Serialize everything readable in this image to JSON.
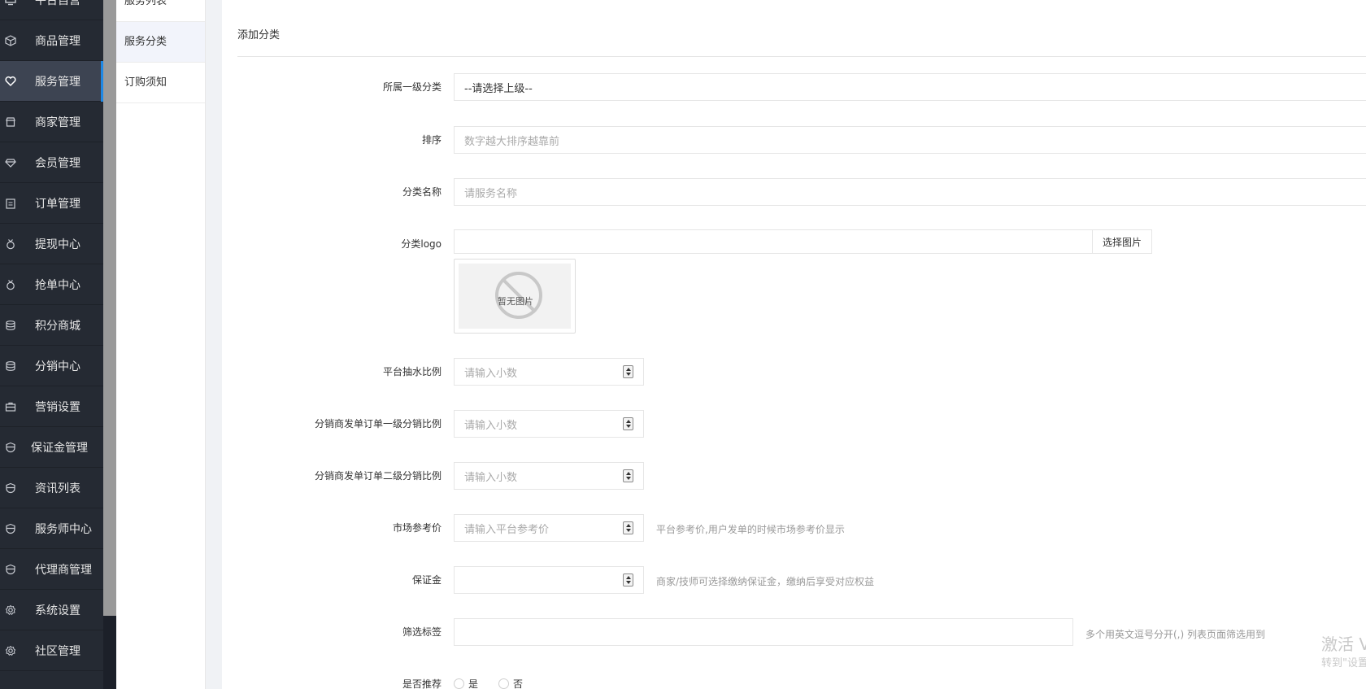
{
  "sidebar": {
    "items": [
      {
        "label": "平台自营",
        "icon": "monitor-icon"
      },
      {
        "label": "商品管理",
        "icon": "cube-icon"
      },
      {
        "label": "服务管理",
        "icon": "heart-icon",
        "active": true
      },
      {
        "label": "商家管理",
        "icon": "store-icon"
      },
      {
        "label": "会员管理",
        "icon": "diamond-icon"
      },
      {
        "label": "订单管理",
        "icon": "clipboard-icon"
      },
      {
        "label": "提现中心",
        "icon": "medal-icon"
      },
      {
        "label": "抢单中心",
        "icon": "medal-icon"
      },
      {
        "label": "积分商城",
        "icon": "database-icon"
      },
      {
        "label": "分销中心",
        "icon": "database-icon"
      },
      {
        "label": "营销设置",
        "icon": "briefcase-icon"
      },
      {
        "label": "保证金管理",
        "icon": "shield-icon"
      },
      {
        "label": "资讯列表",
        "icon": "shield-icon"
      },
      {
        "label": "服务师中心",
        "icon": "shield-icon"
      },
      {
        "label": "代理商管理",
        "icon": "shield-icon"
      },
      {
        "label": "系统设置",
        "icon": "gear-icon"
      },
      {
        "label": "社区管理",
        "icon": "gear-icon"
      },
      {
        "label": "",
        "icon": "gear-icon"
      }
    ]
  },
  "subnav": {
    "items": [
      {
        "label": "服务列表"
      },
      {
        "label": "服务分类",
        "active": true
      },
      {
        "label": "订购须知"
      }
    ]
  },
  "form": {
    "title": "添加分类",
    "parent_label": "所属一级分类",
    "parent_value": "--请选择上级--",
    "sort_label": "排序",
    "sort_placeholder": "数字越大排序越靠前",
    "name_label": "分类名称",
    "name_placeholder": "请服务名称",
    "logo_label": "分类logo",
    "logo_button": "选择图片",
    "no_image_text": "暂无图片",
    "commission_label": "平台抽水比例",
    "commission_placeholder": "请输入小数",
    "level1_label": "分销商发单订单一级分销比例",
    "level1_placeholder": "请输入小数",
    "level2_label": "分销商发单订单二级分销比例",
    "level2_placeholder": "请输入小数",
    "market_label": "市场参考价",
    "market_placeholder": "请输入平台参考价",
    "market_hint": "平台参考价,用户发单的时候市场参考价显示",
    "deposit_label": "保证金",
    "deposit_hint": "商家/技师可选择缴纳保证金，缴纳后享受对应权益",
    "tags_label": "筛选标签",
    "tags_hint": "多个用英文逗号分开(,) 列表页面筛选用到",
    "recommend_label": "是否推荐",
    "recommend_yes": "是",
    "recommend_no": "否"
  },
  "watermark": {
    "line1": "激活 V",
    "line2": "转到\"设置"
  }
}
